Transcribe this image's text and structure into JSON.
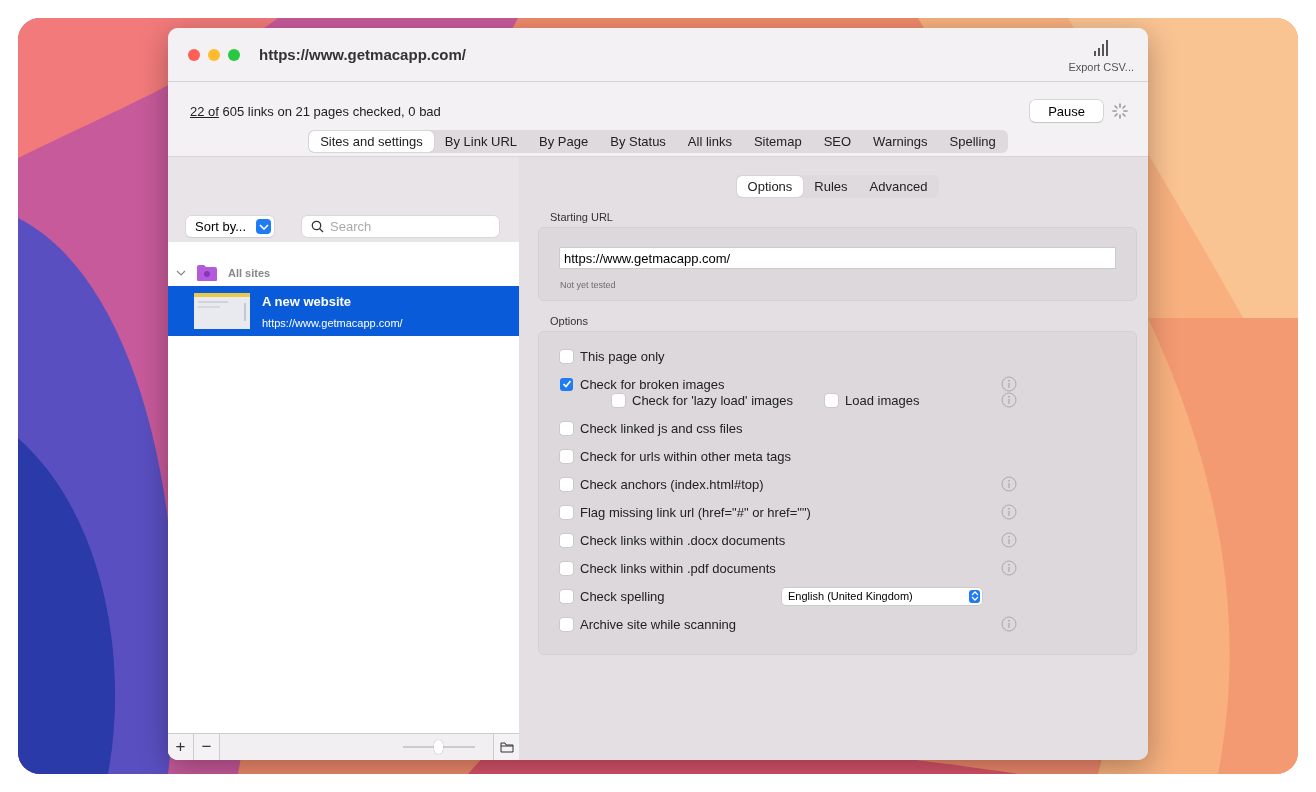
{
  "window": {
    "title": "https://www.getmacapp.com/",
    "export_label": "Export CSV..."
  },
  "status": {
    "link": "22 of",
    "text": "605 links on 21 pages checked, 0 bad",
    "pause": "Pause"
  },
  "tabs": [
    {
      "label": "Sites and settings",
      "selected": true
    },
    {
      "label": "By Link URL",
      "selected": false
    },
    {
      "label": "By Page",
      "selected": false
    },
    {
      "label": "By Status",
      "selected": false
    },
    {
      "label": "All links",
      "selected": false
    },
    {
      "label": "Sitemap",
      "selected": false
    },
    {
      "label": "SEO",
      "selected": false
    },
    {
      "label": "Warnings",
      "selected": false
    },
    {
      "label": "Spelling",
      "selected": false
    }
  ],
  "sidebar": {
    "sort": "Sort by...",
    "search_placeholder": "Search",
    "group": {
      "label": "All sites",
      "expanded": true
    },
    "sites": [
      {
        "name": "A new website",
        "url": "https://www.getmacapp.com/",
        "selected": true
      }
    ],
    "add": "+",
    "remove": "−",
    "zoom_slider": {
      "level": 0.5
    }
  },
  "subtabs": [
    {
      "label": "Options",
      "selected": true
    },
    {
      "label": "Rules",
      "selected": false
    },
    {
      "label": "Advanced",
      "selected": false
    }
  ],
  "starting_url": {
    "heading": "Starting URL",
    "value": "https://www.getmacapp.com/",
    "note": "Not yet tested"
  },
  "options_heading": "Options",
  "options": [
    {
      "kind": "checkbox",
      "label": "This page only",
      "checked": false,
      "info": false
    },
    {
      "kind": "checkbox",
      "label": "Check for broken images",
      "checked": true,
      "info": true
    },
    {
      "kind": "sub",
      "info": true,
      "items": [
        {
          "label": "Check for 'lazy load' images",
          "checked": false
        },
        {
          "label": "Load images",
          "checked": false
        }
      ]
    },
    {
      "kind": "checkbox",
      "label": "Check linked js and css files",
      "checked": false,
      "info": false
    },
    {
      "kind": "checkbox",
      "label": "Check for urls within other meta tags",
      "checked": false,
      "info": false
    },
    {
      "kind": "checkbox",
      "label": "Check anchors (index.html#top)",
      "checked": false,
      "info": true
    },
    {
      "kind": "checkbox",
      "label": "Flag missing link url (href=\"#\" or href=\"\")",
      "checked": false,
      "info": true
    },
    {
      "kind": "checkbox",
      "label": "Check links within .docx documents",
      "checked": false,
      "info": true
    },
    {
      "kind": "checkbox",
      "label": "Check links within .pdf documents",
      "checked": false,
      "info": true
    },
    {
      "kind": "select",
      "label": "Check spelling",
      "checked": false,
      "value": "English (United Kingdom)",
      "info": false
    },
    {
      "kind": "checkbox",
      "label": "Archive site while scanning",
      "checked": false,
      "info": true
    }
  ]
}
